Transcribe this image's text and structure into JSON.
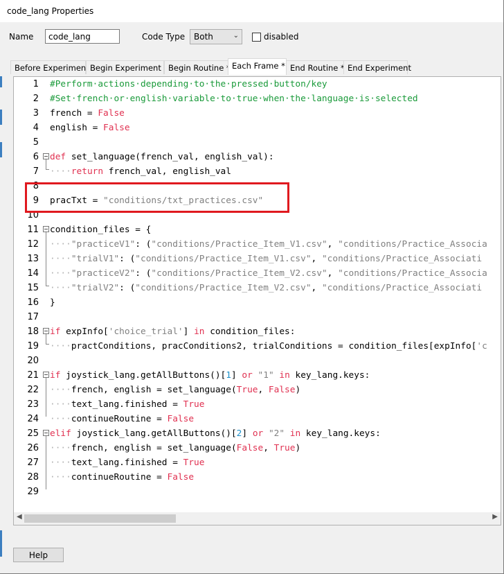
{
  "window": {
    "title": "code_lang Properties"
  },
  "fields": {
    "name_label": "Name",
    "name_value": "code_lang",
    "code_type_label": "Code Type",
    "code_type_value": "Both",
    "disabled_label": "disabled"
  },
  "tabs": [
    {
      "label": "Before Experiment"
    },
    {
      "label": "Begin Experiment *"
    },
    {
      "label": "Begin Routine *"
    },
    {
      "label": "Each Frame *"
    },
    {
      "label": "End Routine *"
    },
    {
      "label": "End Experiment"
    }
  ],
  "active_tab": "Each Frame *",
  "code_lines": [
    {
      "n": "1",
      "tokens": [
        [
          "com",
          "#Perform·actions·depending·to·the·pressed·button/key"
        ]
      ]
    },
    {
      "n": "2",
      "tokens": [
        [
          "com",
          "#Set·french·or·english·variable·to·true·when·the·language·is·selected"
        ]
      ]
    },
    {
      "n": "3",
      "tokens": [
        [
          "norm",
          "french = "
        ],
        [
          "kw",
          "False"
        ]
      ]
    },
    {
      "n": "4",
      "tokens": [
        [
          "norm",
          "english = "
        ],
        [
          "kw",
          "False"
        ]
      ]
    },
    {
      "n": "5",
      "tokens": []
    },
    {
      "n": "6",
      "tokens": [
        [
          "kw",
          "def"
        ],
        [
          "norm",
          " set_language(french_val, english_val):"
        ]
      ]
    },
    {
      "n": "7",
      "tokens": [
        [
          "dot",
          "····"
        ],
        [
          "kw",
          "return"
        ],
        [
          "norm",
          " french_val, english_val"
        ]
      ]
    },
    {
      "n": "8",
      "tokens": []
    },
    {
      "n": "9",
      "tokens": [
        [
          "norm",
          "pracTxt = "
        ],
        [
          "str",
          "\"conditions/txt_practices.csv\""
        ]
      ]
    },
    {
      "n": "10",
      "tokens": []
    },
    {
      "n": "11",
      "tokens": [
        [
          "norm",
          "condition_files = {"
        ]
      ]
    },
    {
      "n": "12",
      "tokens": [
        [
          "dot",
          "····"
        ],
        [
          "str",
          "\"practiceV1\""
        ],
        [
          "norm",
          ": ("
        ],
        [
          "str",
          "\"conditions/Practice_Item_V1.csv\""
        ],
        [
          "norm",
          ", "
        ],
        [
          "str",
          "\"conditions/Practice_Associa"
        ]
      ]
    },
    {
      "n": "13",
      "tokens": [
        [
          "dot",
          "····"
        ],
        [
          "str",
          "\"trialV1\""
        ],
        [
          "norm",
          ": ("
        ],
        [
          "str",
          "\"conditions/Practice_Item_V1.csv\""
        ],
        [
          "norm",
          ", "
        ],
        [
          "str",
          "\"conditions/Practice_Associati"
        ]
      ]
    },
    {
      "n": "14",
      "tokens": [
        [
          "dot",
          "····"
        ],
        [
          "str",
          "\"practiceV2\""
        ],
        [
          "norm",
          ": ("
        ],
        [
          "str",
          "\"conditions/Practice_Item_V2.csv\""
        ],
        [
          "norm",
          ", "
        ],
        [
          "str",
          "\"conditions/Practice_Associa"
        ]
      ]
    },
    {
      "n": "15",
      "tokens": [
        [
          "dot",
          "····"
        ],
        [
          "str",
          "\"trialV2\""
        ],
        [
          "norm",
          ": ("
        ],
        [
          "str",
          "\"conditions/Practice_Item_V2.csv\""
        ],
        [
          "norm",
          ", "
        ],
        [
          "str",
          "\"conditions/Practice_Associati"
        ]
      ]
    },
    {
      "n": "16",
      "tokens": [
        [
          "norm",
          "}"
        ]
      ]
    },
    {
      "n": "17",
      "tokens": []
    },
    {
      "n": "18",
      "tokens": [
        [
          "kw",
          "if"
        ],
        [
          "norm",
          " expInfo["
        ],
        [
          "str",
          "'choice_trial'"
        ],
        [
          "norm",
          "] "
        ],
        [
          "kw",
          "in"
        ],
        [
          "norm",
          " condition_files:"
        ]
      ]
    },
    {
      "n": "19",
      "tokens": [
        [
          "dot",
          "····"
        ],
        [
          "norm",
          "practConditions, pracConditions2, trialConditions = condition_files[expInfo["
        ],
        [
          "str",
          "'c"
        ]
      ]
    },
    {
      "n": "20",
      "tokens": []
    },
    {
      "n": "21",
      "tokens": [
        [
          "kw",
          "if"
        ],
        [
          "norm",
          " joystick_lang.getAllButtons()["
        ],
        [
          "num",
          "1"
        ],
        [
          "norm",
          "] "
        ],
        [
          "kw",
          "or"
        ],
        [
          "norm",
          " "
        ],
        [
          "str",
          "\"1\""
        ],
        [
          "norm",
          " "
        ],
        [
          "kw",
          "in"
        ],
        [
          "norm",
          " key_lang.keys:"
        ]
      ]
    },
    {
      "n": "22",
      "tokens": [
        [
          "dot",
          "····"
        ],
        [
          "norm",
          "french, english = set_language("
        ],
        [
          "kw",
          "True"
        ],
        [
          "norm",
          ", "
        ],
        [
          "kw",
          "False"
        ],
        [
          "norm",
          ")"
        ]
      ]
    },
    {
      "n": "23",
      "tokens": [
        [
          "dot",
          "····"
        ],
        [
          "norm",
          "text_lang.finished = "
        ],
        [
          "kw",
          "True"
        ]
      ]
    },
    {
      "n": "24",
      "tokens": [
        [
          "dot",
          "····"
        ],
        [
          "norm",
          "continueRoutine = "
        ],
        [
          "kw",
          "False"
        ]
      ]
    },
    {
      "n": "25",
      "tokens": [
        [
          "kw",
          "elif"
        ],
        [
          "norm",
          " joystick_lang.getAllButtons()["
        ],
        [
          "num",
          "2"
        ],
        [
          "norm",
          "] "
        ],
        [
          "kw",
          "or"
        ],
        [
          "norm",
          " "
        ],
        [
          "str",
          "\"2\""
        ],
        [
          "norm",
          " "
        ],
        [
          "kw",
          "in"
        ],
        [
          "norm",
          " key_lang.keys:"
        ]
      ]
    },
    {
      "n": "26",
      "tokens": [
        [
          "dot",
          "····"
        ],
        [
          "norm",
          "french, english = set_language("
        ],
        [
          "kw",
          "False"
        ],
        [
          "norm",
          ", "
        ],
        [
          "kw",
          "True"
        ],
        [
          "norm",
          ")"
        ]
      ]
    },
    {
      "n": "27",
      "tokens": [
        [
          "dot",
          "····"
        ],
        [
          "norm",
          "text_lang.finished = "
        ],
        [
          "kw",
          "True"
        ]
      ]
    },
    {
      "n": "28",
      "tokens": [
        [
          "dot",
          "····"
        ],
        [
          "norm",
          "continueRoutine = "
        ],
        [
          "kw",
          "False"
        ]
      ]
    },
    {
      "n": "29",
      "tokens": []
    }
  ],
  "help_button": "Help",
  "colors": {
    "comment": "#1a9a3a",
    "keyword": "#e03050",
    "string": "#808080",
    "number": "#1a8fc9",
    "highlight_box": "#e0191f"
  }
}
